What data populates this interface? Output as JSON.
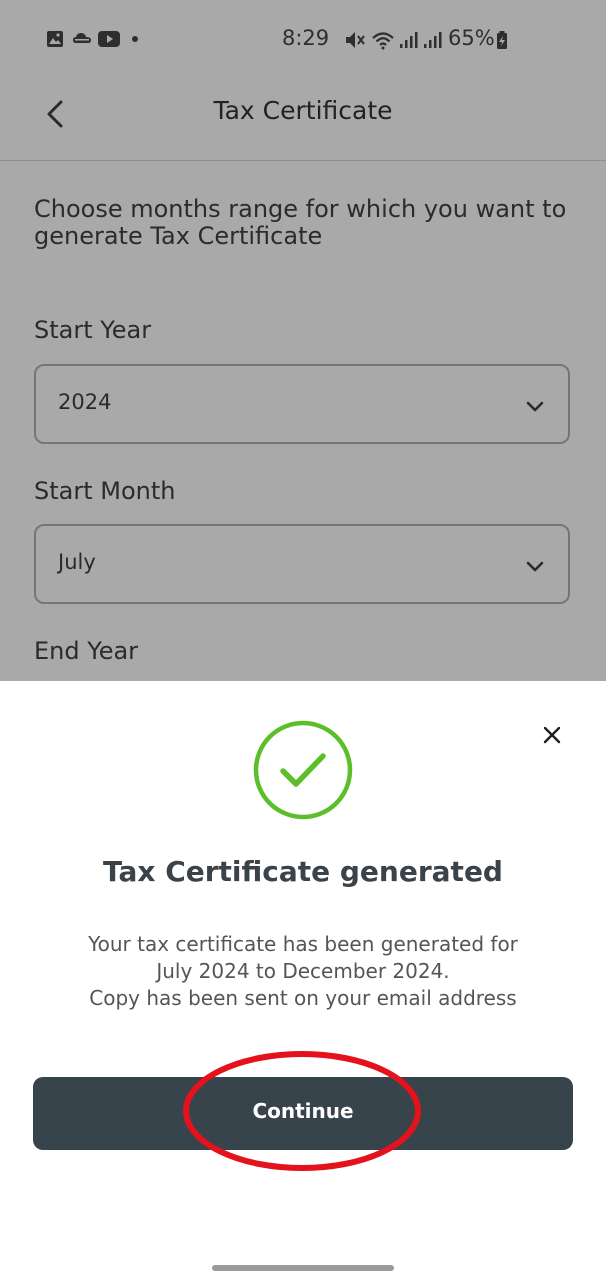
{
  "status_bar": {
    "time": "8:29",
    "battery": "65%"
  },
  "header": {
    "title": "Tax Certificate"
  },
  "form": {
    "intro": "Choose months range for which you want to generate Tax Certificate",
    "start_year_label": "Start Year",
    "start_year_value": "2024",
    "start_month_label": "Start Month",
    "start_month_value": "July",
    "end_year_label": "End Year"
  },
  "sheet": {
    "title": "Tax Certificate generated",
    "message_line1": "Your tax certificate has been generated for",
    "message_line2": "July 2024 to December 2024.",
    "message_line3": "Copy has been sent on your email address",
    "continue_label": "Continue"
  },
  "colors": {
    "overlay_bg": "#a9a9a9",
    "success_green": "#5cbf2a",
    "button_dark": "#37444c",
    "annotation_red": "#e3121c"
  },
  "icons": [
    "image-icon",
    "cloud-icon",
    "youtube-icon",
    "mute-icon",
    "wifi-icon",
    "signal-icon",
    "battery-icon",
    "back-arrow-icon",
    "chevron-down-icon",
    "close-icon",
    "check-circle-icon"
  ]
}
